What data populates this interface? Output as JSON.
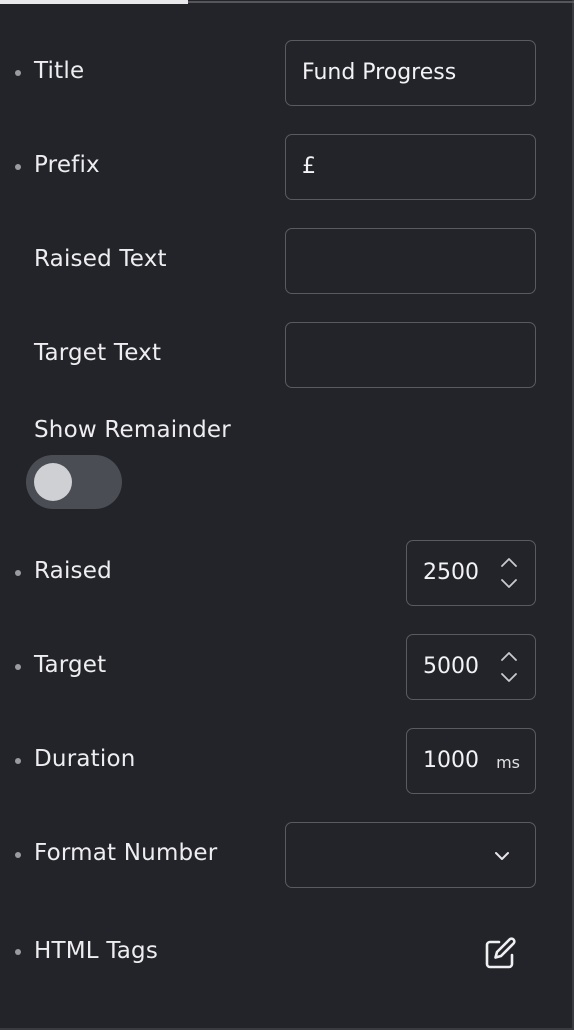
{
  "fields": {
    "title": {
      "label": "Title",
      "value": "Fund Progress"
    },
    "prefix": {
      "label": "Prefix",
      "value": "£"
    },
    "raised_text": {
      "label": "Raised Text",
      "value": ""
    },
    "target_text": {
      "label": "Target Text",
      "value": ""
    },
    "show_remainder": {
      "label": "Show Remainder",
      "enabled": false
    },
    "raised": {
      "label": "Raised",
      "value": "2500"
    },
    "target": {
      "label": "Target",
      "value": "5000"
    },
    "duration": {
      "label": "Duration",
      "value": "1000",
      "unit": "ms"
    },
    "format_number": {
      "label": "Format Number",
      "value": ""
    },
    "html_tags": {
      "label": "HTML Tags"
    }
  },
  "icons": {
    "stepper": "chevron-up-down-icon",
    "dropdown": "chevron-down-icon",
    "edit": "edit-icon"
  },
  "colors": {
    "background": "#232429",
    "field_border": "#5a5b60",
    "text": "#eeeef0",
    "toggle_track": "#4b4d55",
    "toggle_knob": "#cfd0d4"
  }
}
